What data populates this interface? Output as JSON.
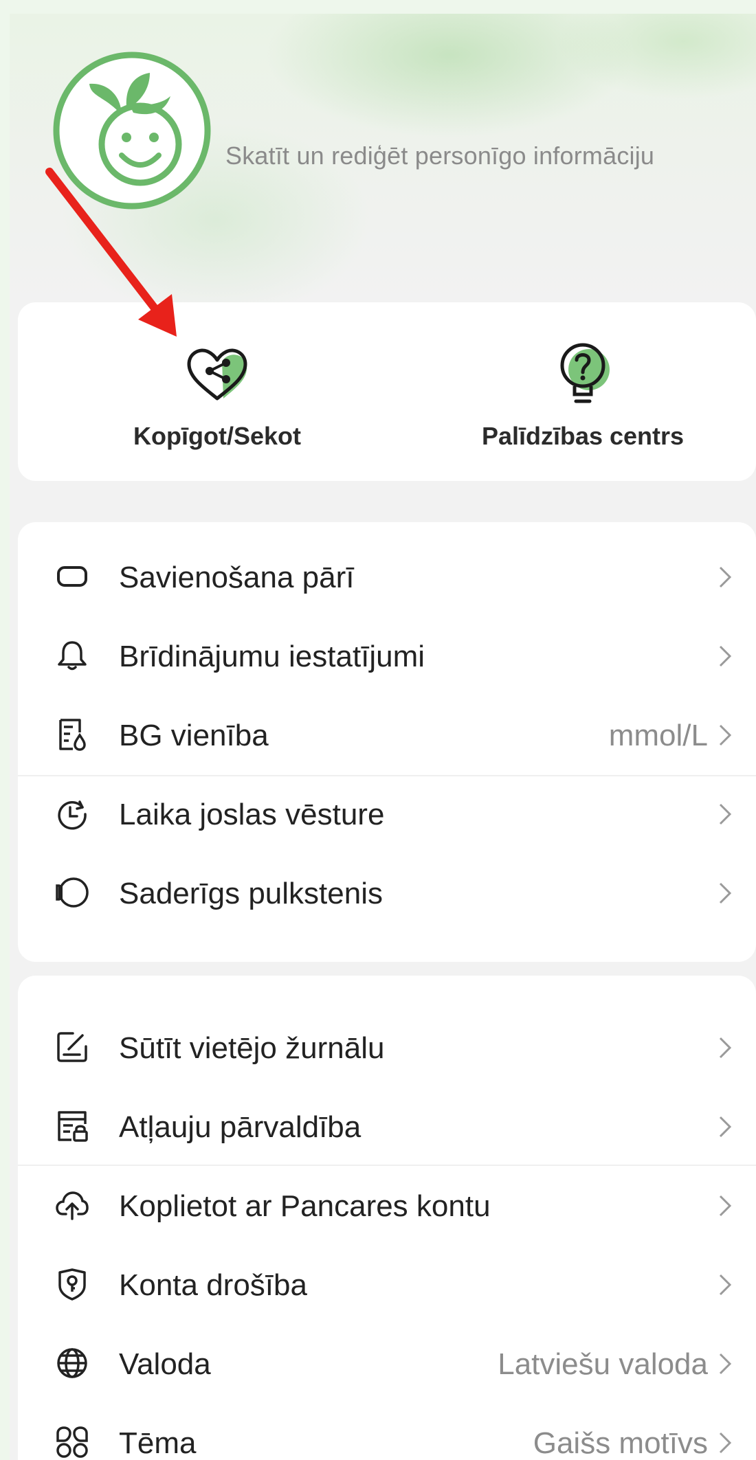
{
  "profile": {
    "hint": "Skatīt un rediģēt personīgo informāciju"
  },
  "quick_actions": [
    {
      "label": "Kopīgot/Sekot",
      "icon": "heart-share-icon"
    },
    {
      "label": "Palīdzības centrs",
      "icon": "lightbulb-question-icon"
    }
  ],
  "settings_group_1": [
    {
      "label": "Savienošana pārī",
      "value": "",
      "icon": "device-pairing-icon"
    },
    {
      "label": "Brīdinājumu iestatījumi",
      "value": "",
      "icon": "bell-icon"
    },
    {
      "label": "BG vienība",
      "value": "mmol/L",
      "icon": "blood-glucose-unit-icon"
    },
    {
      "label": "Laika joslas vēsture",
      "value": "",
      "icon": "clock-history-icon"
    },
    {
      "label": "Saderīgs pulkstenis",
      "value": "",
      "icon": "watch-icon"
    }
  ],
  "settings_group_2": [
    {
      "label": "Sūtīt vietējo žurnālu",
      "value": "",
      "icon": "edit-log-icon"
    },
    {
      "label": "Atļauju pārvaldība",
      "value": "",
      "icon": "permission-lock-icon"
    },
    {
      "label": "Koplietot ar Pancares kontu",
      "value": "",
      "icon": "cloud-upload-icon"
    },
    {
      "label": "Konta drošība",
      "value": "",
      "icon": "shield-icon"
    },
    {
      "label": "Valoda",
      "value": "Latviešu valoda",
      "icon": "globe-icon"
    },
    {
      "label": "Tēma",
      "value": "Gaišs motīvs",
      "icon": "theme-grid-icon"
    }
  ],
  "colors": {
    "accent": "#6bb86a",
    "annotation_arrow": "#e8221b"
  }
}
